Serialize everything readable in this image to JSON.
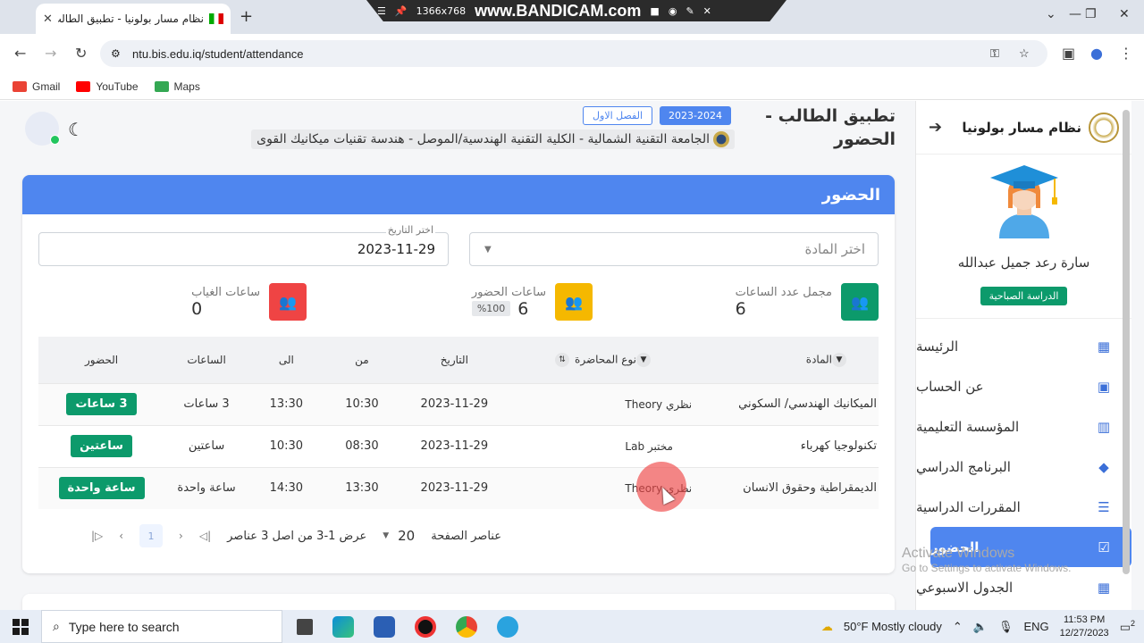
{
  "browser": {
    "tab_title": "نظام مسار بولونيا - تطبيق الطالب",
    "url": "ntu.bis.edu.iq/student/attendance",
    "bookmarks": [
      {
        "label": "Gmail",
        "color": "#ea4335"
      },
      {
        "label": "YouTube",
        "color": "#ff0000"
      },
      {
        "label": "Maps",
        "color": "#34a853"
      }
    ]
  },
  "recorder": {
    "resolution": "1366x768",
    "brand": "www.BANDICAM.com"
  },
  "sidebar": {
    "app_name": "نظام مسار بولونيا",
    "user_name": "سارة رعد جميل عبدالله",
    "study_type": "الدراسة الصباحية",
    "items": [
      {
        "label": "الرئيسة",
        "icon": "dashboard-icon"
      },
      {
        "label": "عن الحساب",
        "icon": "account-icon"
      },
      {
        "label": "المؤسسة التعليمية",
        "icon": "building-icon"
      },
      {
        "label": "البرنامج الدراسي",
        "icon": "graduation-cap-icon"
      },
      {
        "label": "المقررات الدراسية",
        "icon": "list-icon"
      },
      {
        "label": "الحضور",
        "icon": "clipboard-check-icon",
        "active": true
      },
      {
        "label": "الجدول الاسبوعي",
        "icon": "calendar-settings-icon"
      }
    ]
  },
  "header": {
    "title": "تطبيق الطالب - الحضور",
    "academic_year": "2023-2024",
    "semester": "الفصل الاول",
    "subtitle": "الجامعة التقنية الشمالية - الكلية التقنية الهندسية/الموصل - هندسة تقنيات ميكانيك القوى"
  },
  "card": {
    "title": "الحضور",
    "subject_placeholder": "اختر المادة",
    "date_label": "اختر التاريخ",
    "date_value": "2023-11-29"
  },
  "stats": {
    "total": {
      "label": "مجمل عدد الساعات",
      "value": "6",
      "color": "#0c9a6b"
    },
    "present": {
      "label": "ساعات الحضور",
      "value": "6",
      "percent": "%100",
      "color": "#f5b800"
    },
    "absent": {
      "label": "ساعات الغياب",
      "value": "0",
      "color": "#ef4444"
    }
  },
  "table": {
    "headers": {
      "subject": "المادة",
      "lecture_type": "نوع المحاضرة",
      "date": "التاريخ",
      "from": "من",
      "to": "الى",
      "hours": "الساعات",
      "attendance": "الحضور"
    },
    "rows": [
      {
        "subject": "الميكانيك الهندسي/ السكوني",
        "type": "نظري Theory",
        "date": "2023-11-29",
        "from": "10:30",
        "to": "13:30",
        "hours": "3 ساعات",
        "attendance": "3 ساعات"
      },
      {
        "subject": "تكنولوجيا كهرباء",
        "type": "مختبر Lab",
        "date": "2023-11-29",
        "from": "08:30",
        "to": "10:30",
        "hours": "ساعتين",
        "attendance": "ساعتين"
      },
      {
        "subject": "الديمقراطية وحقوق الانسان",
        "type": "نظري Theory",
        "date": "2023-11-29",
        "from": "13:30",
        "to": "14:30",
        "hours": "ساعة واحدة",
        "attendance": "ساعة واحدة"
      }
    ]
  },
  "pagination": {
    "page_size_label": "عناصر الصفحة",
    "page_size": "20",
    "range_text": "عرض 1-3 من اصل 3 عناصر",
    "current_page": "1"
  },
  "watermark": {
    "line1": "Activate Windows",
    "line2": "Go to Settings to activate Windows."
  },
  "taskbar": {
    "search_placeholder": "Type here to search",
    "weather": "50°F  Mostly cloudy",
    "language": "ENG",
    "time": "11:53 PM",
    "date": "12/27/2023",
    "notifications": "2"
  }
}
